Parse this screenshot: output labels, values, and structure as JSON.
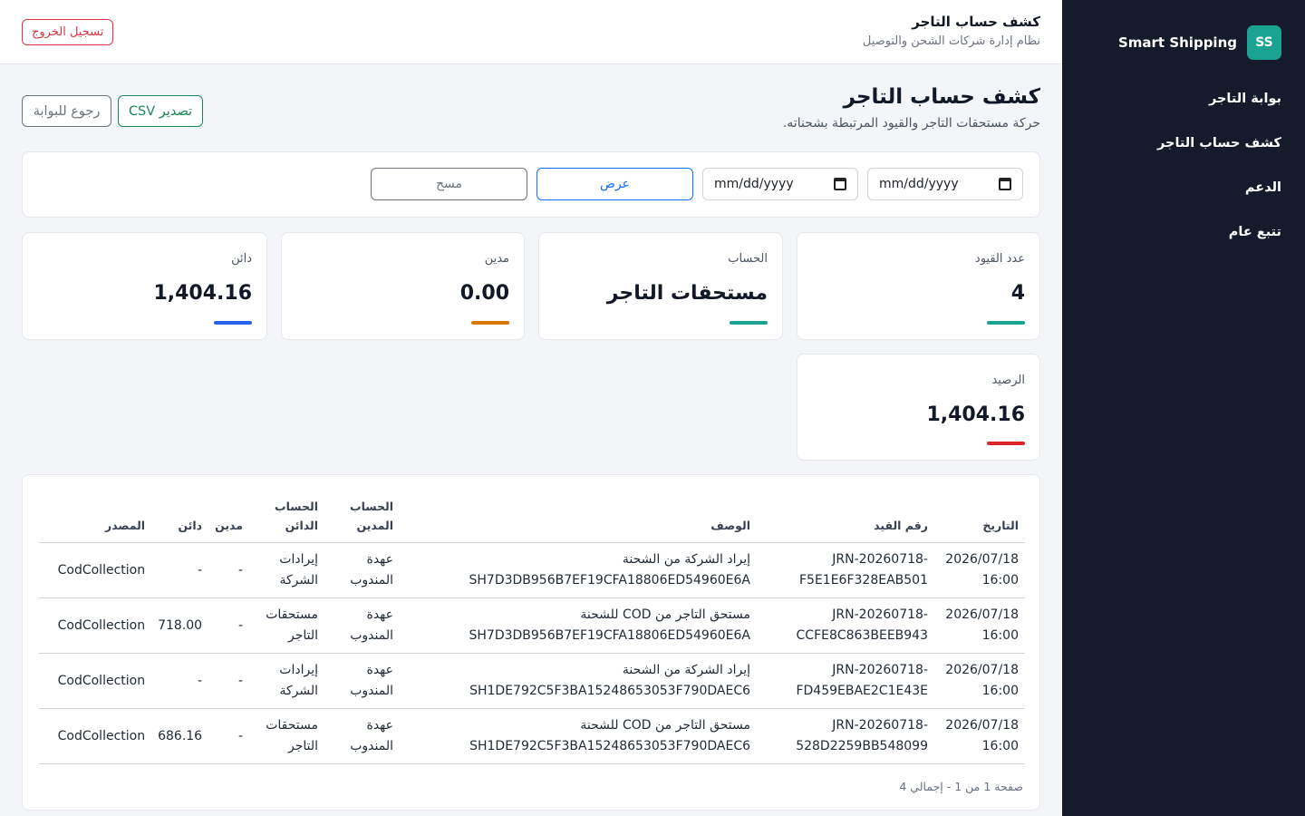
{
  "brand": {
    "badge": "SS",
    "name": "Smart Shipping"
  },
  "nav": [
    {
      "label": "بوابة التاجر"
    },
    {
      "label": "كشف حساب التاجر"
    },
    {
      "label": "الدعم"
    },
    {
      "label": "تتبع عام"
    }
  ],
  "header": {
    "title": "كشف حساب التاجر",
    "subtitle": "نظام إدارة شركات الشحن والتوصيل",
    "logout_label": "تسجيل الخروج"
  },
  "page": {
    "title": "كشف حساب التاجر",
    "subtitle": "حركة مستحقات التاجر والقيود المرتبطة بشحناته.",
    "export_label": "تصدير CSV",
    "back_label": "رجوع للبوابة"
  },
  "filters": {
    "date_from_placeholder": "mm/dd/yyyy",
    "date_to_placeholder": "mm/dd/yyyy",
    "show_label": "عرض",
    "clear_label": "مسح"
  },
  "stats": {
    "entries": {
      "label": "عدد القيود",
      "value": "4",
      "color": "#1aa393"
    },
    "account": {
      "label": "الحساب",
      "value": "مستحقات التاجر",
      "color": "#1aa393"
    },
    "debit": {
      "label": "مدين",
      "value": "0.00",
      "color": "#d97706"
    },
    "credit": {
      "label": "دائن",
      "value": "1,404.16",
      "color": "#2563eb"
    },
    "balance": {
      "label": "الرصيد",
      "value": "1,404.16",
      "color": "#dc2626"
    }
  },
  "table": {
    "headers": {
      "date": "التاريخ",
      "entry_no": "رقم القيد",
      "description": "الوصف",
      "debit_account": "الحساب المدين",
      "credit_account": "الحساب الدائن",
      "debit": "مدين",
      "credit": "دائن",
      "source": "المصدر"
    },
    "rows": [
      {
        "date": "2026/07/18 16:00",
        "entry_no": "JRN-20260718-F5E1E6F328EAB501",
        "description": "إيراد الشركة من الشحنة SH7D3DB956B7EF19CFA18806ED54960E6A",
        "debit_account": "عهدة المندوب",
        "credit_account": "إيرادات الشركة",
        "debit": "-",
        "credit": "-",
        "source": "CodCollection"
      },
      {
        "date": "2026/07/18 16:00",
        "entry_no": "JRN-20260718-CCFE8C863BEEB943",
        "description": "مستحق التاجر من COD للشحنة SH7D3DB956B7EF19CFA18806ED54960E6A",
        "debit_account": "عهدة المندوب",
        "credit_account": "مستحقات التاجر",
        "debit": "-",
        "credit": "718.00",
        "source": "CodCollection"
      },
      {
        "date": "2026/07/18 16:00",
        "entry_no": "JRN-20260718-FD459EBAE2C1E43E",
        "description": "إيراد الشركة من الشحنة SH1DE792C5F3BA15248653053F790DAEC6",
        "debit_account": "عهدة المندوب",
        "credit_account": "إيرادات الشركة",
        "debit": "-",
        "credit": "-",
        "source": "CodCollection"
      },
      {
        "date": "2026/07/18 16:00",
        "entry_no": "JRN-20260718-528D2259BB548099",
        "description": "مستحق التاجر من COD للشحنة SH1DE792C5F3BA15248653053F790DAEC6",
        "debit_account": "عهدة المندوب",
        "credit_account": "مستحقات التاجر",
        "debit": "-",
        "credit": "686.16",
        "source": "CodCollection"
      }
    ],
    "pager": "صفحة 1 من 1 - إجمالي 4"
  }
}
